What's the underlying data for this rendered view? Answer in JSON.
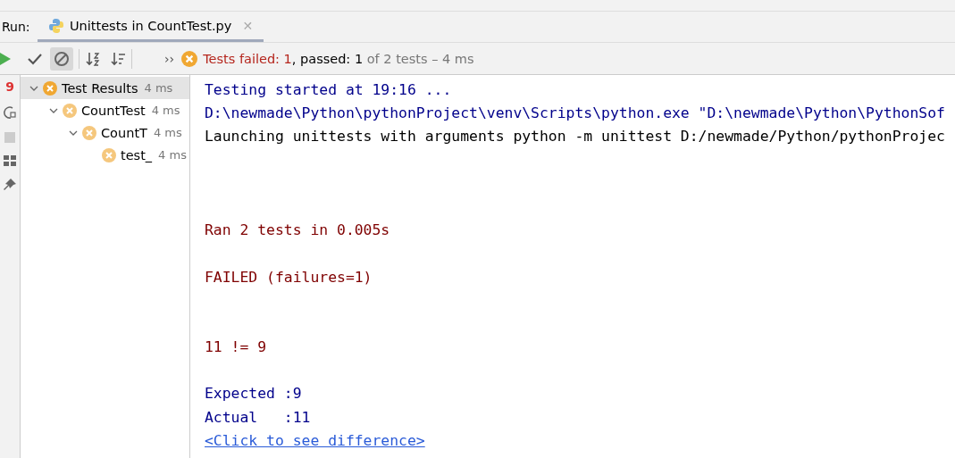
{
  "run_bar": {
    "label": "Run:",
    "tab": {
      "title": "Unittests in CountTest.py",
      "selected": true,
      "close": "✕"
    }
  },
  "toolbar": {
    "show_passed": {
      "selected": false
    },
    "show_ignored": {
      "selected": true
    },
    "more": "››",
    "status": {
      "failed_label": "Tests failed: ",
      "failed_count": "1",
      "passed_label": ", passed: ",
      "passed_count": "1",
      "total": " of 2 tests – 4 ms"
    }
  },
  "side_badge": "9",
  "tree": {
    "label": "Test Results",
    "time": "4 ms",
    "kind": "failed",
    "selected": true,
    "expanded": true,
    "children": [
      {
        "label": "CountTest",
        "time": "4 ms",
        "kind": "failed",
        "selected": false,
        "expanded": true,
        "children": [
          {
            "label": "CountT",
            "time": "4 ms",
            "kind": "failed",
            "selected": false,
            "expanded": true,
            "children": [
              {
                "label": "test_",
                "time": "4 ms",
                "kind": "failed",
                "selected": false
              }
            ]
          }
        ]
      }
    ]
  },
  "console": [
    {
      "kind": "info",
      "text": "Testing started at 19:16 ..."
    },
    {
      "kind": "info",
      "text": "D:\\newmade\\Python\\pythonProject\\venv\\Scripts\\python.exe \"D:\\newmade\\Python\\PythonSof"
    },
    {
      "kind": "plain",
      "text": "Launching unittests with arguments python -m unittest D:/newmade/Python/pythonProjec"
    },
    {
      "kind": "blank"
    },
    {
      "kind": "blank"
    },
    {
      "kind": "blank"
    },
    {
      "kind": "error",
      "text": "Ran 2 tests in 0.005s"
    },
    {
      "kind": "blank"
    },
    {
      "kind": "error",
      "text": "FAILED (failures=1)"
    },
    {
      "kind": "blank"
    },
    {
      "kind": "blank"
    },
    {
      "kind": "error",
      "text": "11 != 9"
    },
    {
      "kind": "blank"
    },
    {
      "kind": "info",
      "text": "Expected :9"
    },
    {
      "kind": "info",
      "text": "Actual   :11"
    },
    {
      "kind": "link",
      "text": "<Click to see difference>"
    }
  ]
}
